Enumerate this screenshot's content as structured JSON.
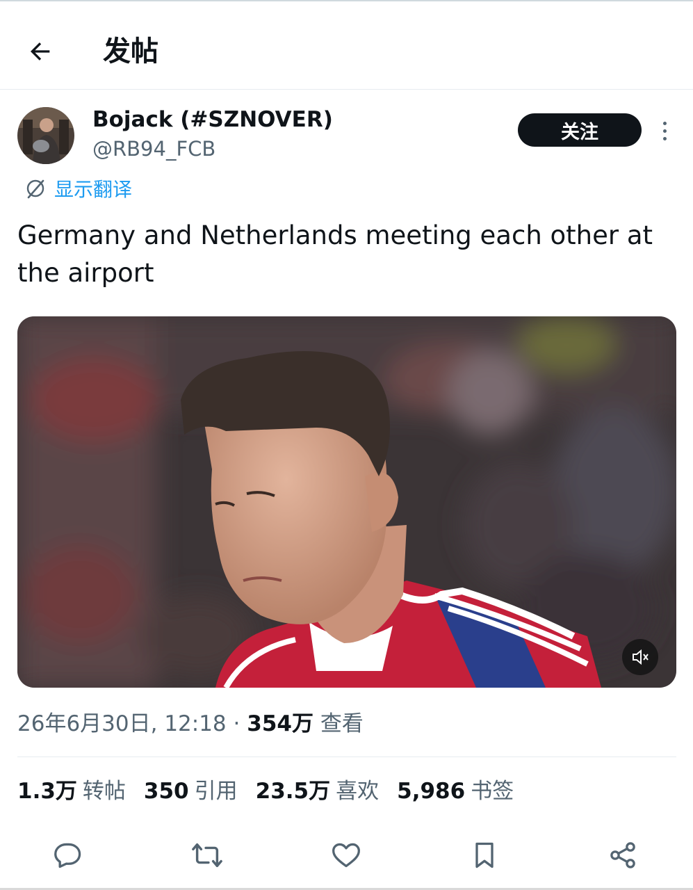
{
  "header": {
    "title": "发帖",
    "back_icon": "arrow-left-icon"
  },
  "author": {
    "display_name": "Bojack (#SZNOVER)",
    "handle": "@RB94_FCB",
    "follow_label": "关注"
  },
  "translate_label": "显示翻译",
  "tweet": {
    "text": "Germany and Netherlands meeting each other at the airport"
  },
  "media": {
    "type": "video",
    "muted": true
  },
  "meta": {
    "datetime": "26年6月30日, 12:18",
    "separator": "·",
    "views_count": "354万",
    "views_label": "查看"
  },
  "stats": [
    {
      "count": "1.3万",
      "label": "转帖"
    },
    {
      "count": "350",
      "label": "引用"
    },
    {
      "count": "23.5万",
      "label": "喜欢"
    },
    {
      "count": "5,986",
      "label": "书签"
    }
  ],
  "actions": [
    "reply-icon",
    "retweet-icon",
    "like-icon",
    "bookmark-icon",
    "share-icon"
  ],
  "colors": {
    "accent": "#1d9bf0",
    "text": "#0f1419",
    "muted": "#536471"
  }
}
